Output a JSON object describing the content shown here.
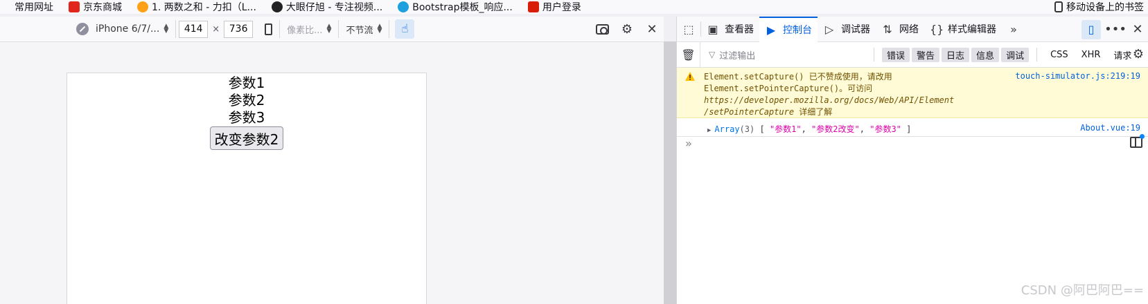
{
  "bookmarks": {
    "items": [
      {
        "label": "常用网址",
        "color": "#ffffff"
      },
      {
        "label": "京东商城",
        "color": "#e1251b"
      },
      {
        "label": "1. 两数之和 - 力扣（L...",
        "color": "#ffa116"
      },
      {
        "label": "大眼仔旭 - 专注视频...",
        "color": "#222222"
      },
      {
        "label": "Bootstrap模板_响应...",
        "color": "#1e9fde"
      },
      {
        "label": "用户登录",
        "color": "#d81e06"
      }
    ],
    "right_label": "移动设备上的书签"
  },
  "rdm": {
    "device": "iPhone 6/7/...",
    "width": "414",
    "times": "×",
    "height": "736",
    "dpr": "像素比...",
    "throttle": "不节流",
    "page": {
      "params": [
        "参数1",
        "参数2",
        "参数3"
      ],
      "button_label": "改变参数2"
    }
  },
  "devtools": {
    "tabs": [
      {
        "label": "查看器",
        "icon": "inspector-icon"
      },
      {
        "label": "控制台",
        "icon": "console-icon",
        "active": true
      },
      {
        "label": "调试器",
        "icon": "debugger-icon"
      },
      {
        "label": "网络",
        "icon": "network-icon"
      },
      {
        "label": "样式编辑器",
        "icon": "style-editor-icon"
      }
    ],
    "filter_placeholder": "过滤输出",
    "filter_buttons": [
      "错误",
      "警告",
      "日志",
      "信息",
      "调试"
    ],
    "filter_texts": [
      "CSS",
      "XHR",
      "请求"
    ],
    "warning": {
      "line1": "Element.setCapture() 已不赞成使用，请改用",
      "line2": "Element.setPointerCapture()。可访问",
      "link1": "https://developer.mozilla.org/docs/Web/API/Element",
      "link2": "/setPointerCapture",
      "tail": " 详细了解",
      "source": "touch-simulator.js:219:19"
    },
    "log": {
      "type": "Array",
      "count": "(3)",
      "open": "[",
      "s1": "\"参数1\"",
      "s2": "\"参数2改变\"",
      "s3": "\"参数3\"",
      "close": "]",
      "source": "About.vue:19"
    },
    "prompt": "»",
    "watermark": "CSDN @阿巴阿巴=="
  },
  "colors": {
    "accent": "#0060df",
    "warning_bg": "#fffbd6",
    "string": "#dd00a9"
  }
}
